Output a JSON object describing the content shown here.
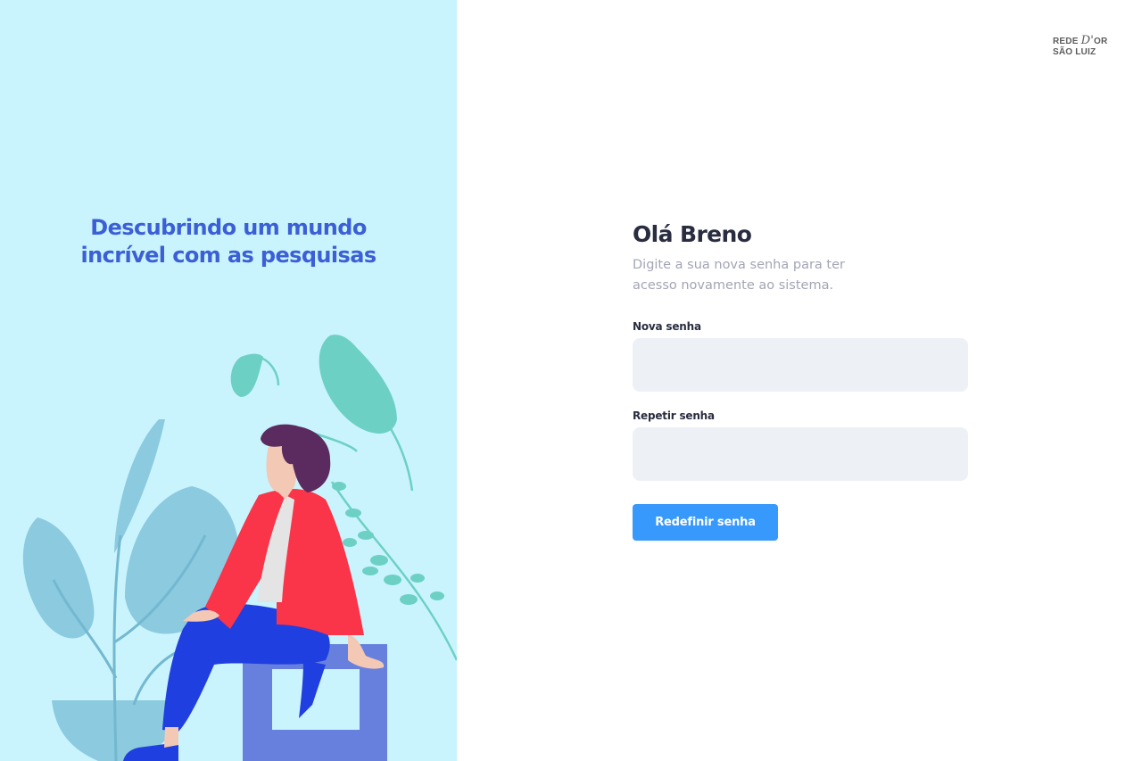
{
  "hero": {
    "headline_line1": "Descubrindo um mundo",
    "headline_line2": "incrível com as pesquisas"
  },
  "brand": {
    "line1_left": "REDE",
    "line1_script": "D'",
    "line1_right": "OR",
    "line2": "SÃO LUIZ"
  },
  "form": {
    "greeting": "Olá Breno",
    "subtitle": "Digite a sua nova senha para ter acesso novamente ao sistema.",
    "new_password_label": "Nova senha",
    "new_password_value": "",
    "repeat_password_label": "Repetir senha",
    "repeat_password_value": "",
    "submit_label": "Redefinir senha"
  },
  "colors": {
    "left_background": "#c9f4fd",
    "headline": "#3d5fd6",
    "primary_button": "#3799fb",
    "input_background": "#edf1f6",
    "heading_text": "#2a2d40",
    "muted_text": "#a3a5b5"
  }
}
